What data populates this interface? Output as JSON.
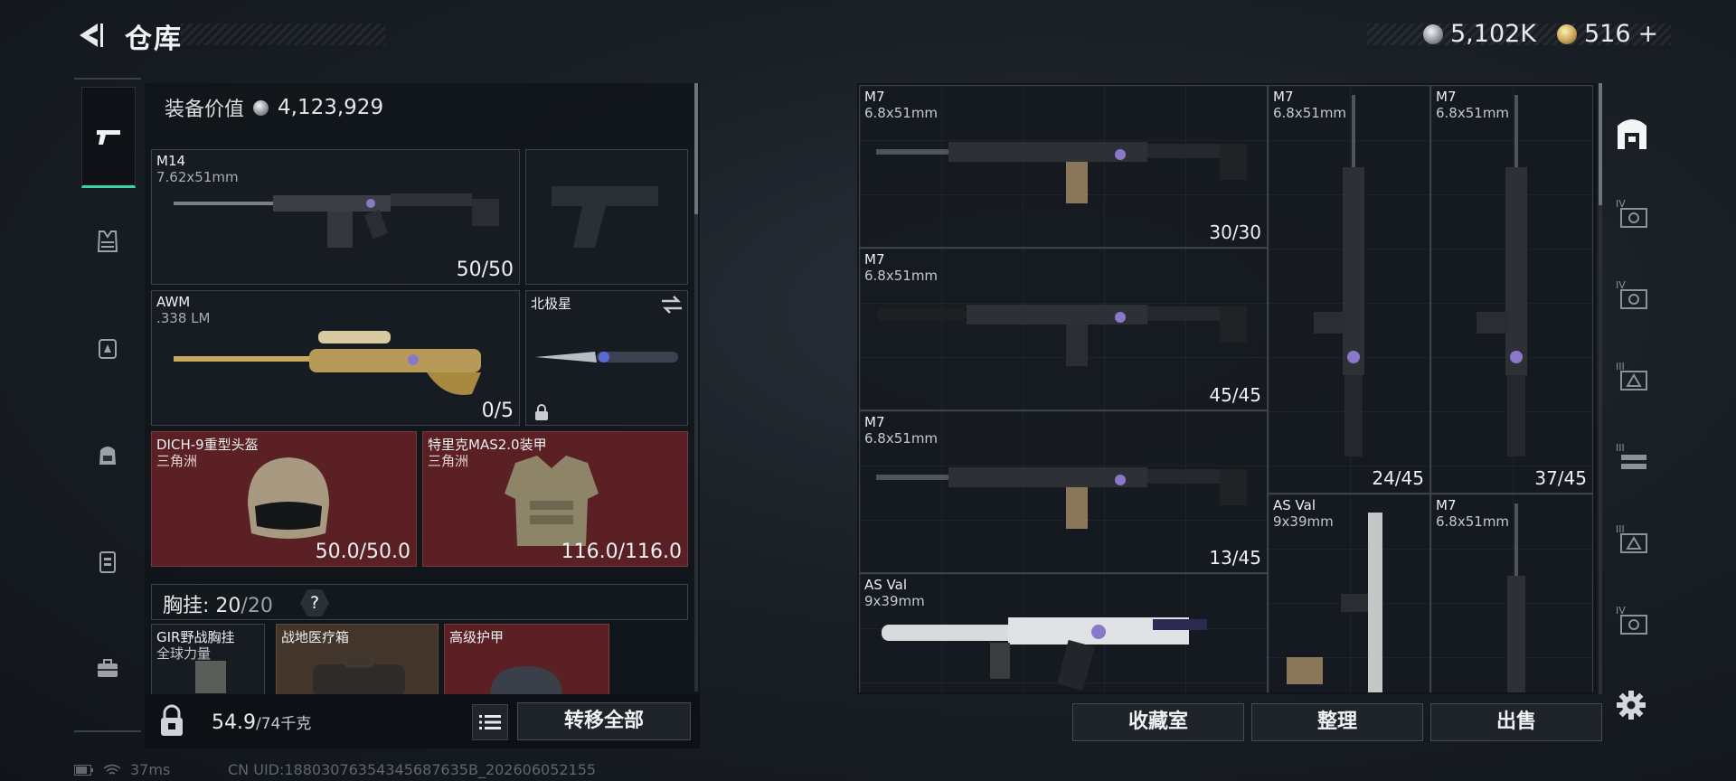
{
  "header": {
    "title": "仓库",
    "currency_silver": "5,102K",
    "currency_gold": "516",
    "currency_gold_add": "+"
  },
  "equipment": {
    "value_label": "装备价值",
    "value": "4,123,929",
    "primary": {
      "name": "M14",
      "caliber": "7.62x51mm",
      "ammo": "50/50"
    },
    "secondary": {
      "name": "AWM",
      "caliber": ".338 LM",
      "ammo": "0/5"
    },
    "melee": {
      "name": "北极星"
    },
    "helmet": {
      "name": "DICH-9重型头盔",
      "source": "三角洲",
      "durability": "50.0/50.0"
    },
    "armor": {
      "name": "特里克MAS2.0装甲",
      "source": "三角洲",
      "durability": "116.0/116.0"
    },
    "chest_rig": {
      "label": "胸挂:",
      "capacity_used": "20",
      "capacity_total": "/20",
      "help": "?"
    },
    "bag_items": [
      {
        "name": "GIR野战胸挂",
        "sub": "全球力量"
      },
      {
        "name": "战地医疗箱",
        "sub": ""
      },
      {
        "name": "高级护甲",
        "sub": ""
      }
    ]
  },
  "footer_left": {
    "weight": "54.9",
    "weight_max": "/74千克",
    "transfer_label": "转移全部"
  },
  "status": {
    "ping": "37ms",
    "uid": "CN UID:18803076354345687635B_202606052155"
  },
  "warehouse": {
    "items": [
      {
        "name": "M7",
        "caliber": "6.8x51mm",
        "ammo": "30/30"
      },
      {
        "name": "M7",
        "caliber": "6.8x51mm",
        "ammo": ""
      },
      {
        "name": "M7",
        "caliber": "6.8x51mm",
        "ammo": ""
      },
      {
        "name": "M7",
        "caliber": "6.8x51mm",
        "ammo": "45/45"
      },
      {
        "name": "M7",
        "caliber": "6.8x51mm",
        "ammo": "13/45"
      },
      {
        "name": "",
        "caliber": "",
        "ammo": "24/45"
      },
      {
        "name": "",
        "caliber": "",
        "ammo": "37/45"
      },
      {
        "name": "AS Val",
        "caliber": "9x39mm",
        "ammo": ""
      },
      {
        "name": "M7",
        "caliber": "6.8x51mm",
        "ammo": ""
      },
      {
        "name": "AS Val",
        "caliber": "9x39mm",
        "ammo": ""
      }
    ]
  },
  "footer_right": {
    "collection_label": "收藏室",
    "sort_label": "整理",
    "sell_label": "出售"
  },
  "right_tabs": [
    "IV",
    "IV",
    "III",
    "III",
    "III",
    "IV"
  ]
}
